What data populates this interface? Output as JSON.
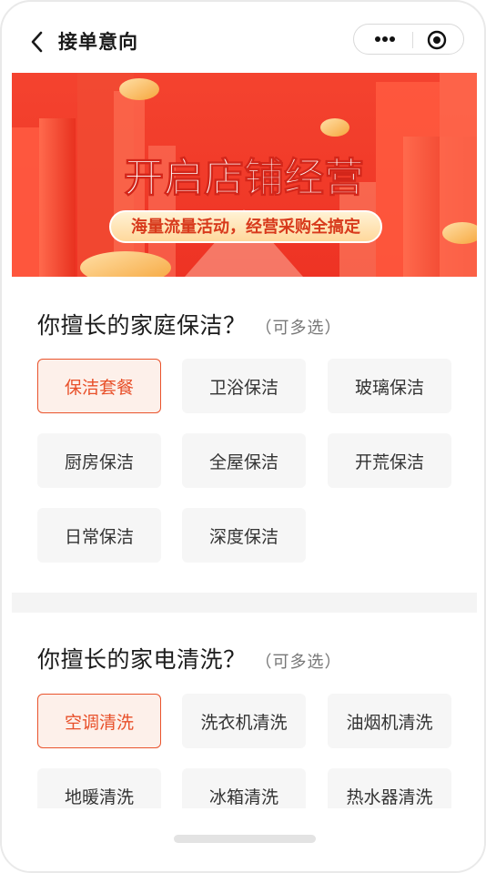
{
  "header": {
    "title": "接单意向",
    "back_icon": "back-chevron-icon",
    "more_icon": "more-dots-icon",
    "target_icon": "close-target-icon"
  },
  "banner": {
    "headline": "开启店铺经营",
    "subline": "海量流量活动，经营采购全搞定",
    "colors": {
      "bg": "#f0392b",
      "accent": "#ffd9a6"
    }
  },
  "sections": [
    {
      "title": "你擅长的家庭保洁？",
      "hint": "（可多选）",
      "options": [
        {
          "label": "保洁套餐",
          "selected": true
        },
        {
          "label": "卫浴保洁",
          "selected": false
        },
        {
          "label": "玻璃保洁",
          "selected": false
        },
        {
          "label": "厨房保洁",
          "selected": false
        },
        {
          "label": "全屋保洁",
          "selected": false
        },
        {
          "label": "开荒保洁",
          "selected": false
        },
        {
          "label": "日常保洁",
          "selected": false
        },
        {
          "label": "深度保洁",
          "selected": false
        }
      ]
    },
    {
      "title": "你擅长的家电清洗？",
      "hint": "（可多选）",
      "options": [
        {
          "label": "空调清洗",
          "selected": true
        },
        {
          "label": "洗衣机清洗",
          "selected": false
        },
        {
          "label": "油烟机清洗",
          "selected": false
        },
        {
          "label": "地暖清洗",
          "selected": false
        },
        {
          "label": "冰箱清洗",
          "selected": false
        },
        {
          "label": "热水器清洗",
          "selected": false
        }
      ]
    }
  ],
  "colors": {
    "selected_text": "#e8502a",
    "selected_border": "#e9532c",
    "chip_bg": "#f6f6f6"
  }
}
